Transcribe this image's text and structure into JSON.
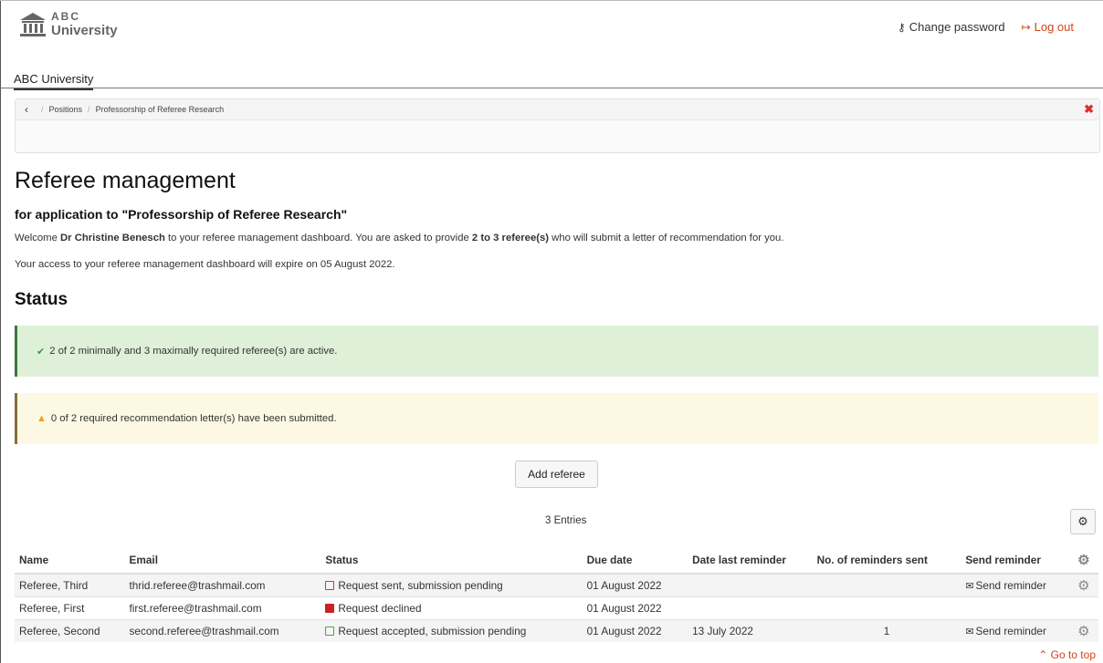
{
  "logo": {
    "line1": "ABC",
    "line2": "University"
  },
  "toplinks": {
    "change_password": "Change password",
    "logout": "Log out"
  },
  "nav": {
    "tab": "ABC University"
  },
  "breadcrumb": {
    "items": [
      "Positions",
      "Professorship of Referee Research"
    ]
  },
  "page": {
    "title": "Referee management",
    "subtitle": "for application to \"Professorship of Referee Research\"",
    "welcome_pre": "Welcome ",
    "welcome_name": "Dr Christine Benesch",
    "welcome_mid": " to your referee management dashboard. You are asked to provide ",
    "welcome_count": "2 to 3 referee(s)",
    "welcome_post": " who will submit a letter of recommendation for you.",
    "access": "Your access to your referee management dashboard will expire on 05 August 2022.",
    "status_heading": "Status"
  },
  "alerts": {
    "ok": "2 of 2 minimally and 3 maximally required referee(s) are active.",
    "warn": "0 of 2 required recommendation letter(s) have been submitted."
  },
  "add_referee": "Add referee",
  "entries": "3 Entries",
  "table": {
    "headers": [
      "Name",
      "Email",
      "Status",
      "Due date",
      "Date last reminder",
      "No. of reminders sent",
      "Send reminder"
    ],
    "rows": [
      {
        "name": "Referee, Third",
        "email": "thrid.referee@trashmail.com",
        "status": "Request sent, submission pending",
        "due": "01 August 2022",
        "last": "",
        "count": "",
        "reminder": "Send reminder"
      },
      {
        "name": "Referee, First",
        "email": "first.referee@trashmail.com",
        "status": "Request declined",
        "due": "01 August 2022",
        "last": "",
        "count": "",
        "reminder": ""
      },
      {
        "name": "Referee, Second",
        "email": "second.referee@trashmail.com",
        "status": "Request accepted, submission pending",
        "due": "01 August 2022",
        "last": "13 July 2022",
        "count": "1",
        "reminder": "Send reminder"
      }
    ]
  },
  "go_to_top": "Go to top",
  "colors": {
    "link_accent": "#d0451b",
    "success_bg": "#dff0d8",
    "warning_bg": "#fcf8e3"
  }
}
